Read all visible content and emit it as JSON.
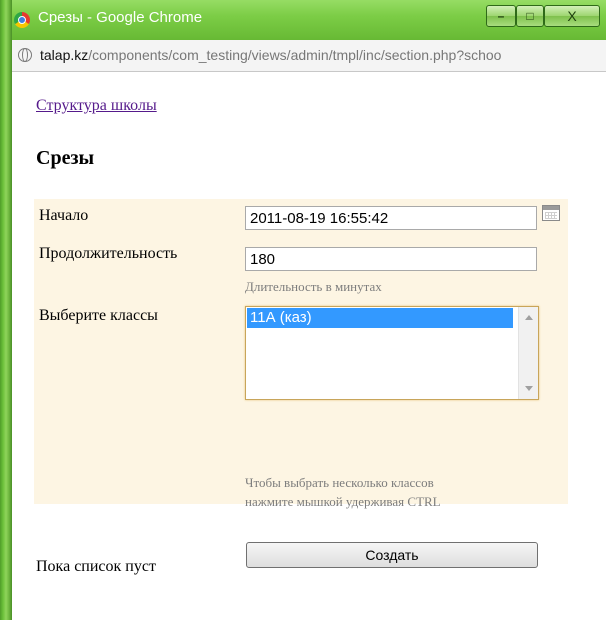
{
  "window": {
    "title": "Срезы - Google Chrome",
    "controls": {
      "minimize": "–",
      "maximize": "□",
      "close": "X"
    }
  },
  "address_bar": {
    "host": "talap.kz",
    "path": "/components/com_testing/views/admin/tmpl/inc/section.php?schoo"
  },
  "page": {
    "breadcrumb": "Структура школы",
    "title": "Срезы",
    "empty_message": "Пока список пуст"
  },
  "form": {
    "start": {
      "label": "Начало",
      "value": "2011-08-19 16:55:42"
    },
    "duration": {
      "label": "Продолжительность",
      "value": "180",
      "hint": "Длительность в минутах"
    },
    "classes": {
      "label": "Выберите классы",
      "options": [
        "11А (каз)"
      ],
      "selected": "11А (каз)",
      "hint_line1": "Чтобы выбрать несколько классов",
      "hint_line2": "нажмите мышкой удерживая CTRL"
    },
    "submit_label": "Создать"
  },
  "colors": {
    "title_bar": "#7ccd46",
    "form_background": "#fdf5e3",
    "link": "#551a8b",
    "selection": "#3399ff"
  }
}
